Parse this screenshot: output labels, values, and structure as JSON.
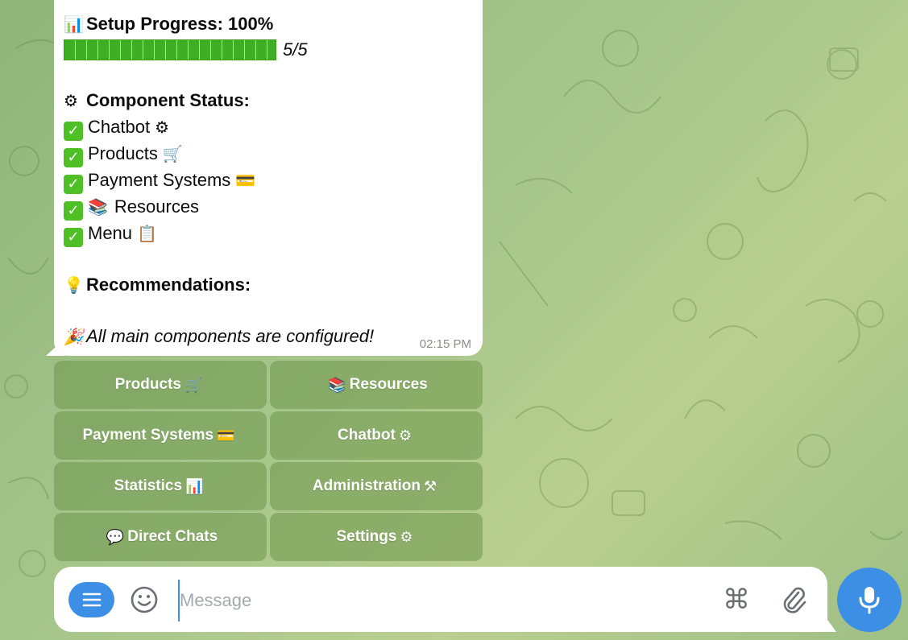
{
  "message": {
    "progress_title": "Setup Progress: 100%",
    "progress_fraction": "5/5",
    "progress_value": 1.0,
    "status_heading": "Component Status:",
    "components": [
      {
        "label": "Chatbot",
        "icon": "gear-icon",
        "glyph": "⚙"
      },
      {
        "label": "Products",
        "icon": "cart-icon",
        "glyph": "🛒"
      },
      {
        "label": "Payment Systems",
        "icon": "credit-card-icon",
        "glyph": "💳"
      },
      {
        "label": "Resources",
        "icon": "books-icon",
        "glyph": "📚"
      },
      {
        "label": "Menu",
        "icon": "clipboard-icon",
        "glyph": "📋"
      }
    ],
    "recommendations_heading": "Recommendations:",
    "final_text": "All main components are configured!",
    "time": "02:15 PM"
  },
  "keyboard": {
    "buttons": [
      {
        "label": "Products",
        "glyph": "🛒",
        "icon": "cart-icon"
      },
      {
        "label": "Resources",
        "glyph": "📚",
        "icon": "books-icon"
      },
      {
        "label": "Payment Systems",
        "glyph": "💳",
        "icon": "credit-card-icon"
      },
      {
        "label": "Chatbot",
        "glyph": "⚙",
        "icon": "gear-icon"
      },
      {
        "label": "Statistics",
        "glyph": "📊",
        "icon": "bar-chart-icon"
      },
      {
        "label": "Administration",
        "glyph": "⚒",
        "icon": "tools-icon"
      },
      {
        "label": "Direct Chats",
        "glyph": "💬",
        "icon": "speech-bubble-icon"
      },
      {
        "label": "Settings",
        "glyph": "⚙",
        "icon": "gear-icon"
      }
    ]
  },
  "composer": {
    "placeholder": "Message"
  },
  "colors": {
    "accent": "#3d8fe6",
    "progress": "#3fae24",
    "check": "#4fbf26",
    "keyboard_button": "#6d964b"
  }
}
